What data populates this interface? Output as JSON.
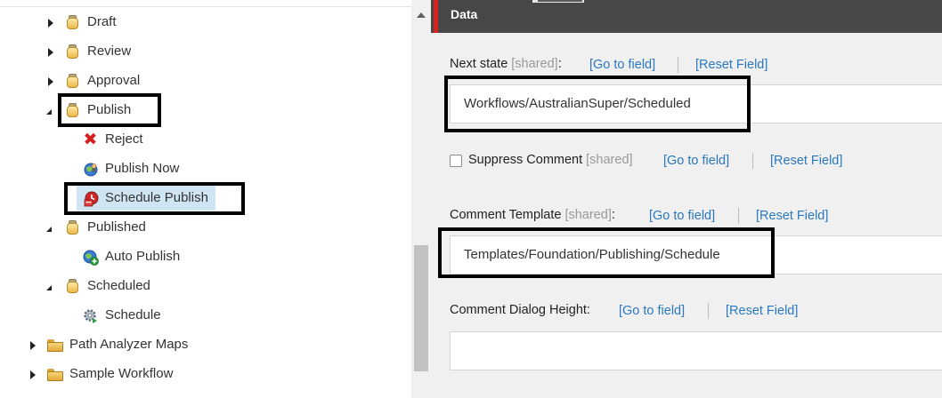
{
  "tree": {
    "items": [
      {
        "label": "Draft",
        "icon": "workflow-state-icon",
        "state": "collapsed"
      },
      {
        "label": "Review",
        "icon": "workflow-state-icon",
        "state": "collapsed"
      },
      {
        "label": "Approval",
        "icon": "workflow-state-icon",
        "state": "collapsed"
      },
      {
        "label": "Publish",
        "icon": "workflow-state-icon",
        "state": "expanded"
      },
      {
        "label": "Reject",
        "icon": "red-x-icon"
      },
      {
        "label": "Publish Now",
        "icon": "globe-user-icon"
      },
      {
        "label": "Schedule Publish",
        "icon": "schedule-publish-icon",
        "selected": true
      },
      {
        "label": "Published",
        "icon": "workflow-state-icon",
        "state": "expanded"
      },
      {
        "label": "Auto Publish",
        "icon": "globe-add-icon"
      },
      {
        "label": "Scheduled",
        "icon": "workflow-state-icon",
        "state": "expanded"
      },
      {
        "label": "Schedule",
        "icon": "gear-icon"
      },
      {
        "label": "Path Analyzer Maps",
        "icon": "folder-icon",
        "state": "collapsed"
      },
      {
        "label": "Sample Workflow",
        "icon": "folder-icon",
        "state": "collapsed"
      }
    ]
  },
  "section": {
    "title": "Data",
    "accent_color": "#d9211f",
    "header_color": "#474747"
  },
  "fields": {
    "next_state": {
      "label": "Next state",
      "shared": "[shared]",
      "colon": ":",
      "go_to_field": "[Go to field]",
      "reset_field": "[Reset Field]",
      "value": "Workflows/AustralianSuper/Scheduled"
    },
    "suppress_comment": {
      "label": "Suppress Comment",
      "shared": "[shared]",
      "go_to_field": "[Go to field]",
      "reset_field": "[Reset Field]",
      "checked": false
    },
    "comment_template": {
      "label": "Comment Template",
      "shared": "[shared]",
      "colon": ":",
      "go_to_field": "[Go to field]",
      "reset_field": "[Reset Field]",
      "value": "Templates/Foundation/Publishing/Schedule"
    },
    "comment_dialog_height": {
      "label": "Comment Dialog Height:",
      "go_to_field": "[Go to field]",
      "reset_field": "[Reset Field]",
      "value": ""
    }
  }
}
